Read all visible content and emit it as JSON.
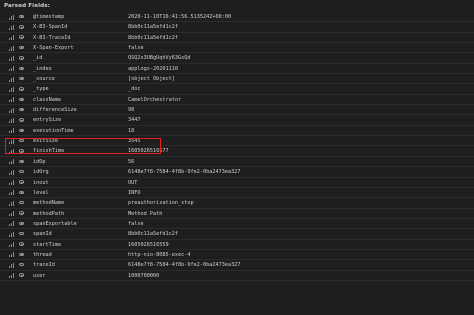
{
  "panel": {
    "title": "Parsed Fields:"
  },
  "fields": [
    {
      "key": "@timestamp",
      "value": "2020-11-10T16:41:56.513524Z+00:00"
    },
    {
      "key": "X-B3-SpanId",
      "value": "8bb0c11a5efd1c2f"
    },
    {
      "key": "X-B3-TraceId",
      "value": "8bb0c11a5efd1c2f"
    },
    {
      "key": "X-Span-Export",
      "value": "false"
    },
    {
      "key": "_id",
      "value": "QSQ2s3UBgUqhVy63GsQd"
    },
    {
      "key": "_index",
      "value": "applogs-20201110"
    },
    {
      "key": "_source",
      "value": "[object Object]"
    },
    {
      "key": "_type",
      "value": "_doc"
    },
    {
      "key": "className",
      "value": "CamelOrchestrator"
    },
    {
      "key": "differenceSize",
      "value": "98"
    },
    {
      "key": "entrySize",
      "value": "3447"
    },
    {
      "key": "executionTime",
      "value": "18"
    },
    {
      "key": "exitSize",
      "value": "3545"
    },
    {
      "key": "finishTime",
      "value": "1605026516577"
    },
    {
      "key": "idOp",
      "value": "56"
    },
    {
      "key": "idOrg",
      "value": "6148e7f8-7584-4f8b-9fe2-0ba2473ea327"
    },
    {
      "key": "inout",
      "value": "OUT"
    },
    {
      "key": "level",
      "value": "INFO"
    },
    {
      "key": "methodName",
      "value": "preauthorization_stop"
    },
    {
      "key": "methodPath",
      "value": "Method Path"
    },
    {
      "key": "spanExportable",
      "value": "false"
    },
    {
      "key": "spanId",
      "value": "8bb0c11a5efd1c2f"
    },
    {
      "key": "startTime",
      "value": "1605026516559"
    },
    {
      "key": "thread",
      "value": "http-nio-8085-exec-4"
    },
    {
      "key": "traceId",
      "value": "6148e7f8-7584-4f8b-9fe2-0ba2473ea327"
    },
    {
      "key": "user",
      "value": "1000700000"
    }
  ],
  "icons": {
    "row_left": "bar-chart-icon",
    "row_right": "eye-icon"
  },
  "colors": {
    "background": "#1e1e1e",
    "text": "#d0d0d0",
    "highlight": "#e0211f"
  }
}
